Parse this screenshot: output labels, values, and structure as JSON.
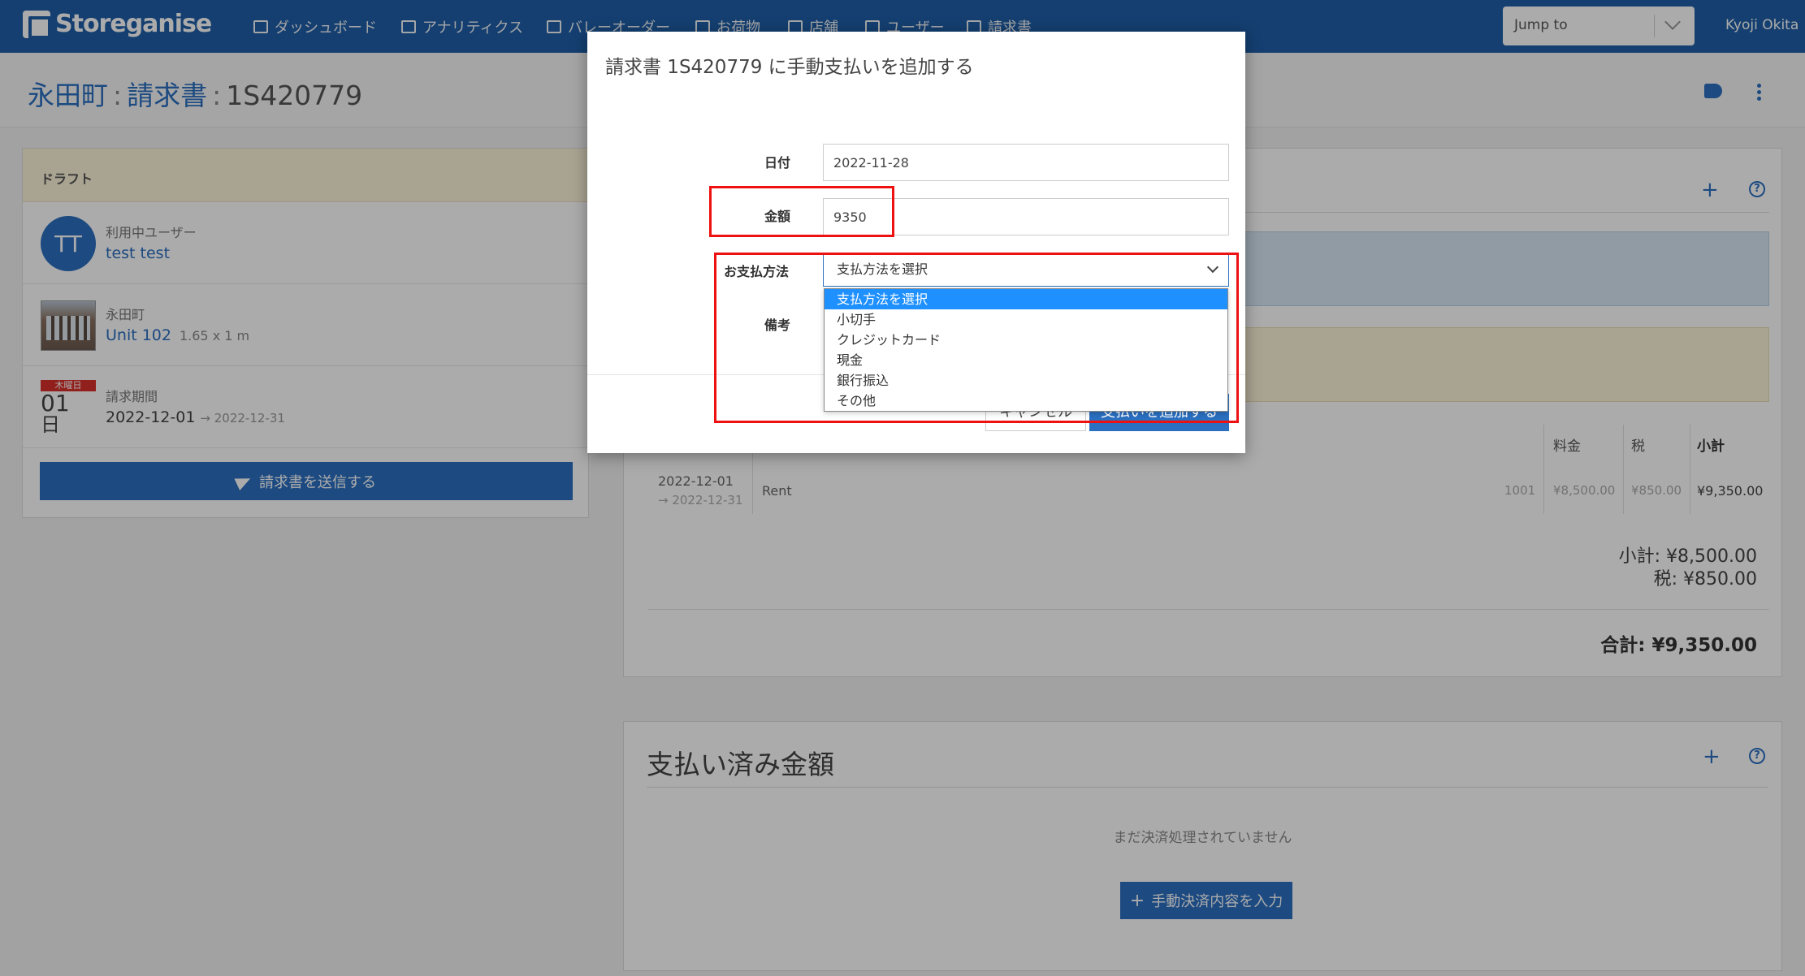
{
  "nav": {
    "brand": "Storeganise",
    "items": [
      {
        "label": "ダッシュボード",
        "icon": "sitemap-icon"
      },
      {
        "label": "アナリティクス",
        "icon": "chart-icon"
      },
      {
        "label": "バレーオーダー",
        "icon": "truck-icon"
      },
      {
        "label": "お荷物",
        "icon": "box-icon"
      },
      {
        "label": "店舗",
        "icon": "building-icon"
      },
      {
        "label": "ユーザー",
        "icon": "user-icon"
      },
      {
        "label": "請求書",
        "icon": "file-icon"
      }
    ],
    "jump_placeholder": "Jump to",
    "user": "Kyoji Okita"
  },
  "header": {
    "site": "永田町",
    "section": "請求書",
    "invoice_no": "1S420779"
  },
  "left": {
    "status": "ドラフト",
    "user_label": "利用中ユーザー",
    "user_initials": "TT",
    "user_name": "test test",
    "site_label": "永田町",
    "unit": "Unit 102",
    "unit_size": "1.65 x 1 m",
    "cal_weekday": "木曜日",
    "cal_day": "01",
    "cal_month": "日",
    "period_label": "請求期間",
    "period_start": "2022-12-01",
    "period_end": "→ 2022-12-31",
    "send_button": "請求書を送信する"
  },
  "lines": {
    "headers": {
      "price": "料金",
      "tax": "税",
      "subtotal": "小計"
    },
    "row": {
      "start": "2022-12-01",
      "end": "→ 2022-12-31",
      "desc": "Rent",
      "code": "1001",
      "price": "¥8,500.00",
      "tax": "¥850.00",
      "subtotal": "¥9,350.00"
    },
    "subtotal_text": "小計: ¥8,500.00",
    "tax_text": "税: ¥850.00",
    "total_text": "合計: ¥9,350.00"
  },
  "payments": {
    "title": "支払い済み金額",
    "empty": "まだ決済処理されていません",
    "add_button": "手動決済内容を入力"
  },
  "modal": {
    "title": "請求書 1S420779 に手動支払いを追加する",
    "date_label": "日付",
    "date_value": "2022-11-28",
    "amount_label": "金額",
    "amount_value": "9350",
    "method_label": "お支払方法",
    "method_selected": "支払方法を選択",
    "notes_label": "備考",
    "options": [
      "支払方法を選択",
      "小切手",
      "クレジットカード",
      "現金",
      "銀行振込",
      "その他"
    ],
    "cancel": "キャンセル",
    "submit": "支払いを追加する"
  },
  "colors": {
    "primary": "#2a6fc0",
    "nav": "#1f5fa8",
    "annotation": "#e11111",
    "highlight": "#1e90ff"
  }
}
